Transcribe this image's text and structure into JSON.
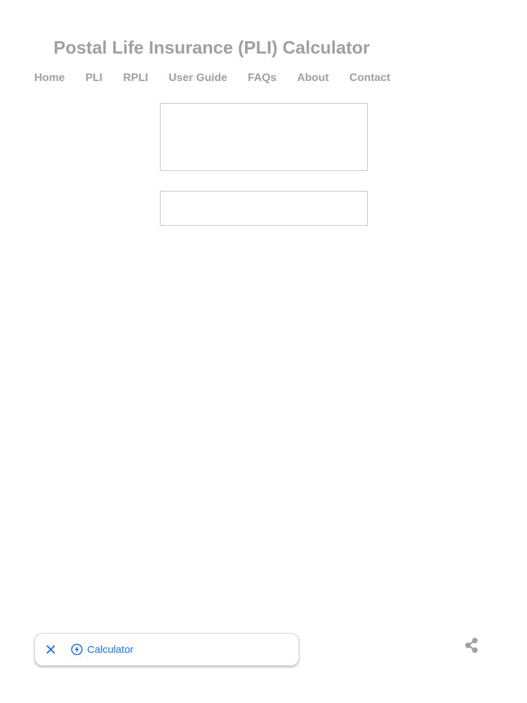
{
  "header": {
    "title": "Postal Life Insurance (PLI) Calculator"
  },
  "nav": {
    "items": [
      {
        "label": "Home"
      },
      {
        "label": "PLI"
      },
      {
        "label": "RPLI"
      },
      {
        "label": "User Guide"
      },
      {
        "label": "FAQs"
      },
      {
        "label": "About"
      },
      {
        "label": "Contact"
      }
    ]
  },
  "bottom_chip": {
    "close_icon": "close-icon",
    "link_icon": "bolt-circle-icon",
    "label": "Calculator",
    "accent_color": "#1a73e8"
  },
  "share": {
    "icon": "share-icon"
  }
}
